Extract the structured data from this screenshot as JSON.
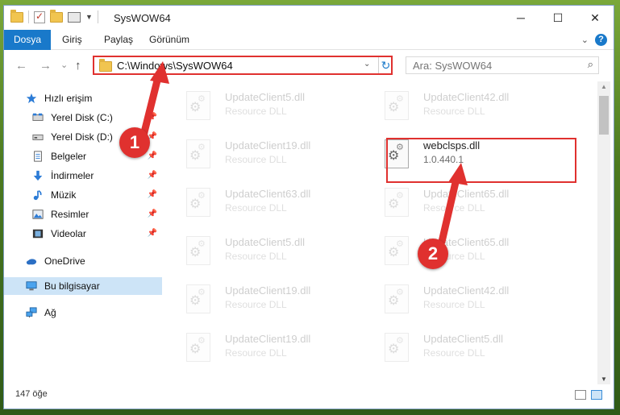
{
  "window": {
    "title": "SysWOW64"
  },
  "quick_access_toolbar": {
    "icons": [
      "folder-icon",
      "properties-icon",
      "new-folder-icon",
      "customize-icon"
    ]
  },
  "window_controls": {
    "minimize": "─",
    "maximize": "☐",
    "close": "✕"
  },
  "ribbon": {
    "tabs": [
      {
        "label": "Dosya",
        "active": true
      },
      {
        "label": "Giriş"
      },
      {
        "label": "Paylaş"
      },
      {
        "label": "Görünüm"
      }
    ],
    "expand_icon": "chevron-down-icon",
    "help_label": "?"
  },
  "navigation": {
    "back": "←",
    "forward": "→",
    "recent": "⌄",
    "up": "↑"
  },
  "address_bar": {
    "path": "C:\\Windows\\SysWOW64",
    "dropdown": "⌄",
    "refresh": "↻"
  },
  "search": {
    "placeholder": "Ara: SysWOW64",
    "icon": "⌕"
  },
  "sidebar": {
    "items": [
      {
        "label": "Hızlı erişim",
        "icon": "star-icon",
        "pinned": false
      },
      {
        "label": "Yerel Disk (C:)",
        "icon": "drive-icon",
        "pinned": true
      },
      {
        "label": "Yerel Disk (D:)",
        "icon": "drive-icon",
        "pinned": true
      },
      {
        "label": "Belgeler",
        "icon": "document-icon",
        "pinned": true
      },
      {
        "label": "İndirmeler",
        "icon": "download-icon",
        "pinned": true
      },
      {
        "label": "Müzik",
        "icon": "music-icon",
        "pinned": true
      },
      {
        "label": "Resimler",
        "icon": "picture-icon",
        "pinned": true
      },
      {
        "label": "Videolar",
        "icon": "video-icon",
        "pinned": true
      },
      {
        "label": "OneDrive",
        "icon": "cloud-icon",
        "pinned": false
      },
      {
        "label": "Bu bilgisayar",
        "icon": "computer-icon",
        "pinned": false,
        "selected": true
      },
      {
        "label": "Ağ",
        "icon": "network-icon",
        "pinned": false
      }
    ]
  },
  "files": [
    {
      "name": "UpdateClient5.dll",
      "desc": "Resource DLL"
    },
    {
      "name": "UpdateClient42.dll",
      "desc": "Resource DLL"
    },
    {
      "name": "UpdateClient19.dll",
      "desc": "Resource DLL"
    },
    {
      "name": "webclsps.dll",
      "desc": "1.0.440.1",
      "highlighted": true
    },
    {
      "name": "UpdateClient63.dll",
      "desc": "Resource DLL"
    },
    {
      "name": "UpdateClient65.dll",
      "desc": "Resource DLL"
    },
    {
      "name": "UpdateClient5.dll",
      "desc": "Resource DLL"
    },
    {
      "name": "UpdateClient65.dll",
      "desc": "Resource DLL"
    },
    {
      "name": "UpdateClient19.dll",
      "desc": "Resource DLL"
    },
    {
      "name": "UpdateClient42.dll",
      "desc": "Resource DLL"
    },
    {
      "name": "UpdateClient19.dll",
      "desc": "Resource DLL"
    },
    {
      "name": "UpdateClient5.dll",
      "desc": "Resource DLL"
    }
  ],
  "status_bar": {
    "item_count": "147 öğe"
  },
  "callouts": [
    {
      "number": "1"
    },
    {
      "number": "2"
    }
  ],
  "colors": {
    "accent": "#1979ca",
    "callout": "#e0312f",
    "selection": "#cde4f7"
  }
}
